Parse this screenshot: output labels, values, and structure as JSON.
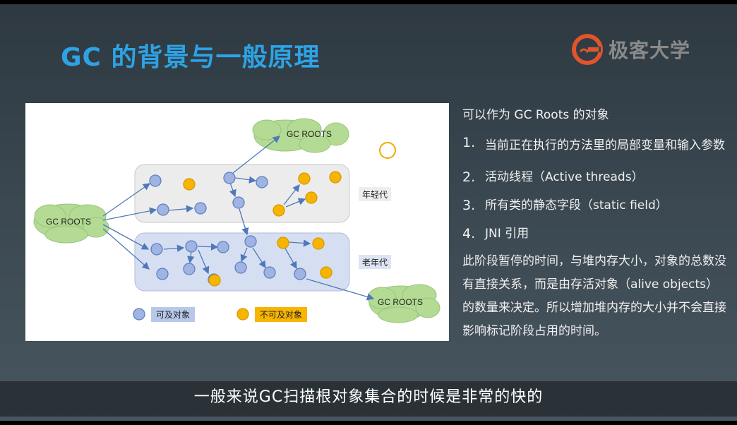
{
  "slide": {
    "title": "GC 的背景与一般原理",
    "logo": {
      "icon": "geekbang-logo-icon",
      "text": "极客大学",
      "color": "#e2542b"
    }
  },
  "diagram": {
    "roots_label": "GC ROOTS",
    "young_gen_label": "年轻代",
    "old_gen_label": "老年代",
    "legend": {
      "reachable": "可及对象",
      "unreachable": "不可及对象"
    },
    "colors": {
      "reachable": "#9fb4e3",
      "unreachable": "#f7b400",
      "cloud": "#b3db93",
      "edge": "#4f79b9"
    }
  },
  "panel": {
    "heading": "可以作为 GC Roots 的对象",
    "items": [
      {
        "num": "1.",
        "text": "当前正在执行的方法里的局部变量和输入参数"
      },
      {
        "num": "2.",
        "text": "活动线程（Active threads）"
      },
      {
        "num": "3.",
        "text": "所有类的静态字段（static field）"
      },
      {
        "num": "4.",
        "text": "JNI 引用"
      }
    ],
    "paragraph": "此阶段暂停的时间，与堆内存大小，对象的总数没有直接关系，而是由存活对象（alive objects）的数量来决定。所以增加堆内存的大小并不会直接影响标记阶段占用的时间。"
  },
  "subtitle": "一般来说GC扫描根对象集合的时候是非常的快的"
}
